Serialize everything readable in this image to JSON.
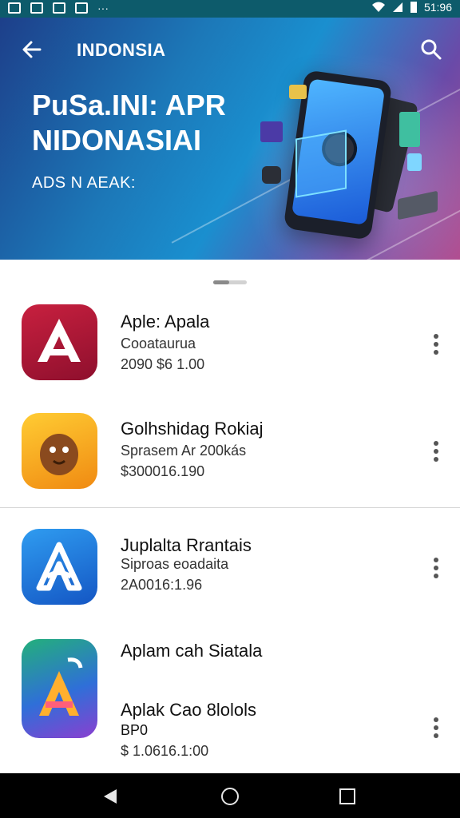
{
  "status_bar": {
    "time": "51:96"
  },
  "header": {
    "title": "INDONSIA",
    "headline_line1": "PuSa.INI: APR",
    "headline_line2": "NIDONASIAI",
    "subline": "ADS N AEAK:"
  },
  "apps": [
    {
      "name": "Aple: Apala",
      "subtitle": "Cooataurua",
      "meta": "2090 $6 1.00",
      "icon": "red-a-logo-icon",
      "color": "#b3153a"
    },
    {
      "name": "Golhshidag Rokiaj",
      "subtitle": "Sprasem Ar 200kás",
      "meta": "$300016.190",
      "icon": "brown-creature-icon",
      "color": "#f7a21c"
    },
    {
      "name": "Juplalta Rrantais",
      "subtitle": "Siproas eoadaita",
      "meta": "2A0016:1.96",
      "icon": "blue-a-logo-icon",
      "color": "#1a76d2"
    },
    {
      "name": "Aplam cah Siatala",
      "subtitle": "Aplak Cao 8lolols",
      "subtitle2": "BP0",
      "meta": "$ 1.0616.1:00",
      "icon": "gradient-a-logo-icon",
      "color": "#7a4bd8"
    }
  ],
  "colors": {
    "status": "#0d5b6b",
    "nav": "#000000",
    "accent": "#1a8fcf"
  }
}
